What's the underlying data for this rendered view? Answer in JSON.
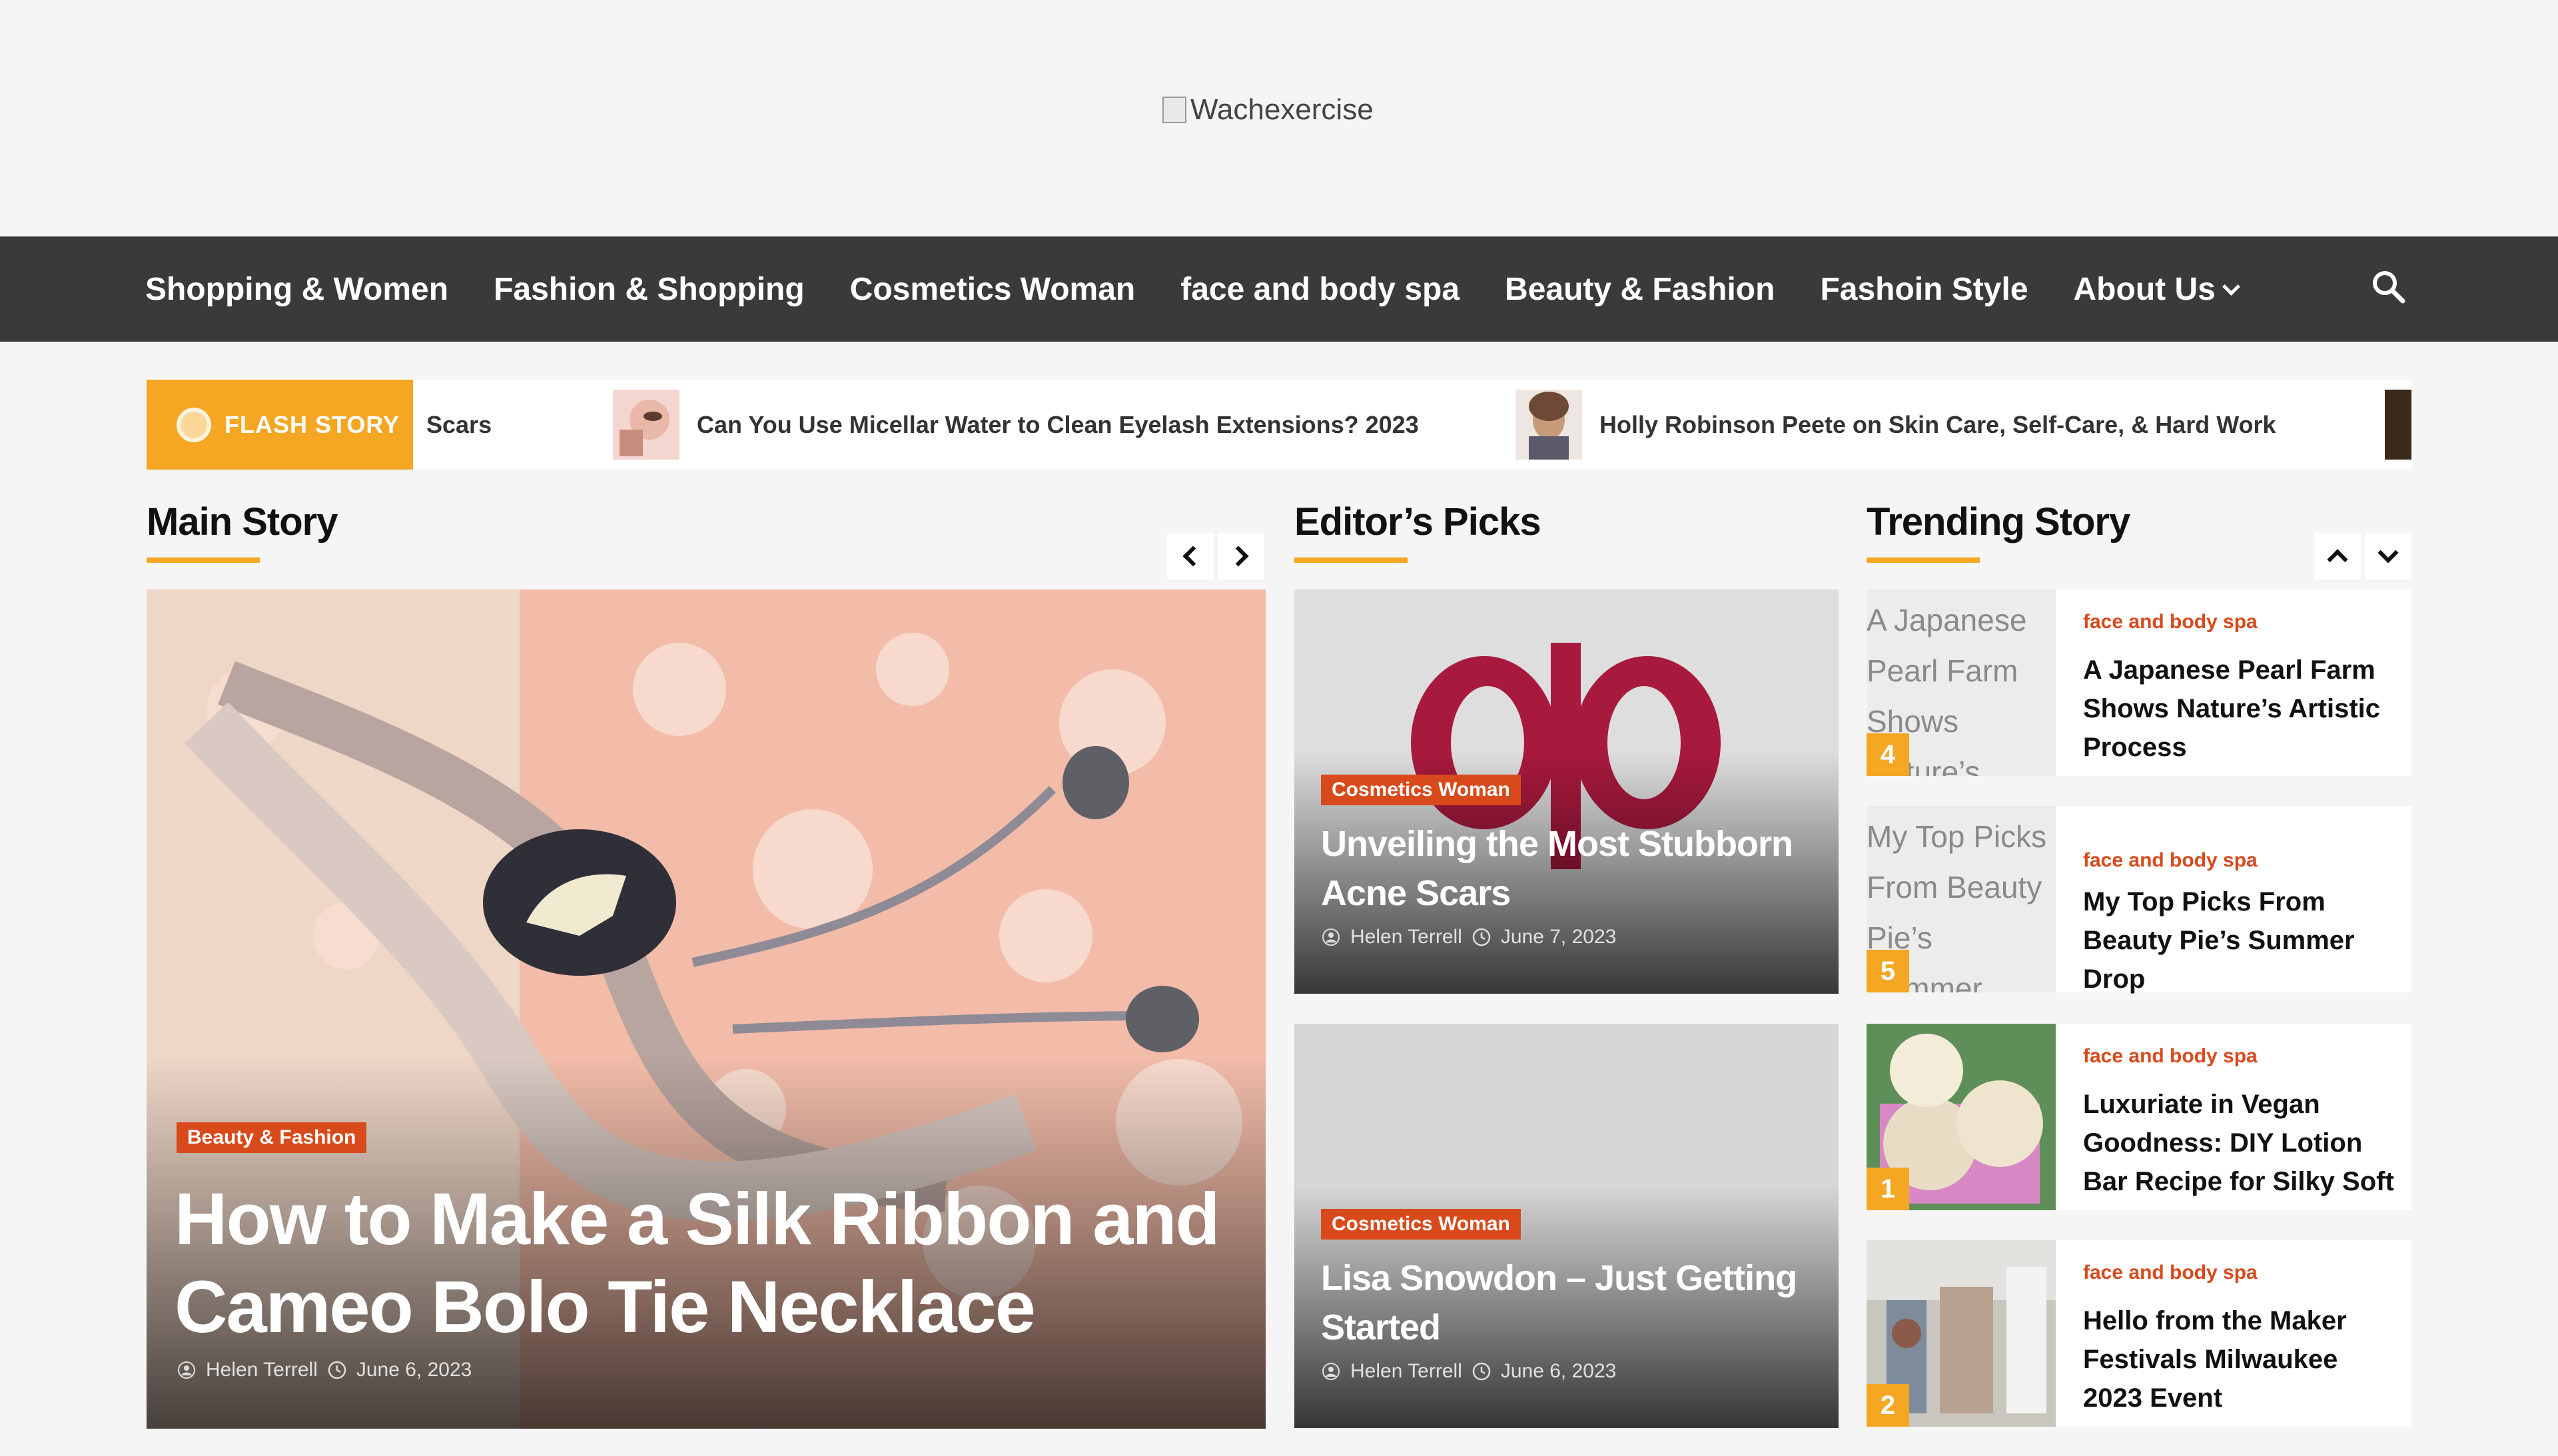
{
  "header": {
    "logo_alt": "Wachexercise"
  },
  "nav": {
    "items": [
      "Shopping & Women",
      "Fashion & Shopping",
      "Cosmetics Woman",
      "face and body spa",
      "Beauty & Fashion",
      "Fashoin Style",
      "About Us"
    ],
    "search_icon": "search-icon"
  },
  "flash": {
    "label": "FLASH STORY",
    "items": [
      {
        "title": "Scars"
      },
      {
        "title": "Can You Use Micellar Water to Clean Eyelash Extensions? 2023"
      },
      {
        "title": "Holly Robinson Peete on Skin Care, Self-Care, & Hard Work"
      }
    ]
  },
  "main_story": {
    "heading": "Main Story",
    "category": "Beauty & Fashion",
    "title": "How to Make a Silk Ribbon and Cameo Bolo Tie Necklace",
    "author": "Helen Terrell",
    "date": "June 6, 2023"
  },
  "editors_picks": {
    "heading": "Editor’s Picks",
    "items": [
      {
        "category": "Cosmetics Woman",
        "title": "Unveiling the Most Stubborn Acne Scars",
        "author": "Helen Terrell",
        "date": "June 7, 2023"
      },
      {
        "category": "Cosmetics Woman",
        "title": "Lisa Snowdon – Just Getting Started",
        "author": "Helen Terrell",
        "date": "June 6, 2023"
      }
    ]
  },
  "trending": {
    "heading": "Trending Story",
    "items": [
      {
        "img_alt": "A Japanese Pearl Farm Shows Nature’s",
        "number": "4",
        "category": "face and body spa",
        "title": "A Japanese Pearl Farm Shows Nature’s Artistic Process"
      },
      {
        "img_alt": "My Top Picks From Beauty Pie’s Summer Drop",
        "number": "5",
        "category": "face and body spa",
        "title": "My Top Picks From Beauty Pie’s Summer Drop"
      },
      {
        "img_alt": "",
        "number": "1",
        "category": "face and body spa",
        "title": "Luxuriate in Vegan Goodness: DIY Lotion Bar Recipe for Silky Soft Skin – Vegan Beauty Review |"
      },
      {
        "img_alt": "",
        "number": "2",
        "category": "face and body spa",
        "title": "Hello from the Maker Festivals Milwaukee 2023 Event"
      }
    ]
  },
  "colors": {
    "accent": "#f5a623",
    "category": "#d84a1b",
    "navbar": "#3a3a3a"
  }
}
